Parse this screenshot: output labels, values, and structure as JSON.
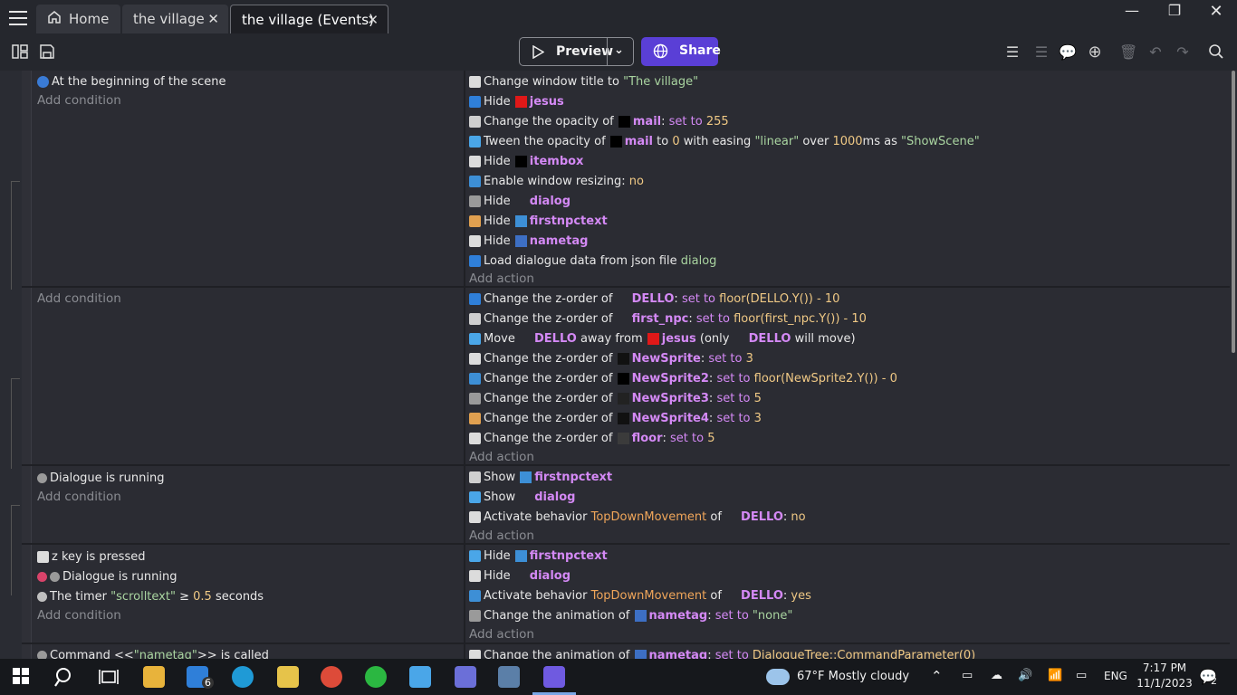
{
  "window": {
    "tabs": [
      {
        "label": "Home"
      },
      {
        "label": "the village"
      },
      {
        "label": "the village (Events)"
      }
    ]
  },
  "toolbar": {
    "preview_label": "Preview",
    "share_label": "Share"
  },
  "events": [
    {
      "conditions": [
        {
          "text": "At the beginning of the scene"
        }
      ],
      "add_condition": "Add condition",
      "actions": [
        {
          "parts": [
            [
              "",
              "Change window title to "
            ],
            [
              "str",
              "\"The village\""
            ]
          ]
        },
        {
          "parts": [
            [
              "",
              "Hide "
            ],
            [
              "obj",
              "jesus"
            ]
          ]
        },
        {
          "parts": [
            [
              "",
              "Change the opacity of "
            ],
            [
              "obj",
              "mail"
            ],
            [
              "",
              ": "
            ],
            [
              "kw",
              "set to "
            ],
            [
              "val",
              "255"
            ]
          ]
        },
        {
          "parts": [
            [
              "",
              "Tween the opacity of "
            ],
            [
              "obj",
              "mail"
            ],
            [
              "",
              " to "
            ],
            [
              "val",
              "0"
            ],
            [
              "",
              " with easing "
            ],
            [
              "str",
              "\"linear\""
            ],
            [
              "",
              " over "
            ],
            [
              "val",
              "1000"
            ],
            [
              "",
              "ms as "
            ],
            [
              "str",
              "\"ShowScene\""
            ]
          ]
        },
        {
          "parts": [
            [
              "",
              "Hide "
            ],
            [
              "obj",
              "itembox"
            ]
          ]
        },
        {
          "parts": [
            [
              "",
              "Enable window resizing: "
            ],
            [
              "val",
              "no"
            ]
          ]
        },
        {
          "parts": [
            [
              "",
              "Hide "
            ],
            [
              "obj",
              "dialog"
            ]
          ]
        },
        {
          "parts": [
            [
              "",
              "Hide "
            ],
            [
              "obj",
              "firstnpctext"
            ]
          ]
        },
        {
          "parts": [
            [
              "",
              "Hide "
            ],
            [
              "obj",
              "nametag"
            ]
          ]
        },
        {
          "parts": [
            [
              "",
              "Load dialogue data from json file "
            ],
            [
              "str",
              "dialog"
            ]
          ]
        }
      ],
      "add_action": "Add action"
    },
    {
      "conditions": [],
      "add_condition": "Add condition",
      "actions": [
        {
          "parts": [
            [
              "",
              "Change the z-order of "
            ],
            [
              "obj",
              "DELLO"
            ],
            [
              "",
              ": "
            ],
            [
              "kw",
              "set to "
            ],
            [
              "val",
              "floor(DELLO.Y()) - 10"
            ]
          ]
        },
        {
          "parts": [
            [
              "",
              "Change the z-order of "
            ],
            [
              "obj",
              "first_npc"
            ],
            [
              "",
              ": "
            ],
            [
              "kw",
              "set to "
            ],
            [
              "val",
              "floor(first_npc.Y()) - 10"
            ]
          ]
        },
        {
          "parts": [
            [
              "",
              "Move "
            ],
            [
              "obj",
              "DELLO"
            ],
            [
              "",
              " away from "
            ],
            [
              "obj",
              "jesus"
            ],
            [
              "",
              " (only "
            ],
            [
              "obj",
              "DELLO"
            ],
            [
              "",
              " will move)"
            ]
          ]
        },
        {
          "parts": [
            [
              "",
              "Change the z-order of "
            ],
            [
              "obj",
              "NewSprite"
            ],
            [
              "",
              ": "
            ],
            [
              "kw",
              "set to "
            ],
            [
              "val",
              "3"
            ]
          ]
        },
        {
          "parts": [
            [
              "",
              "Change the z-order of "
            ],
            [
              "obj",
              "NewSprite2"
            ],
            [
              "",
              ": "
            ],
            [
              "kw",
              "set to "
            ],
            [
              "val",
              "floor(NewSprite2.Y()) - 0"
            ]
          ]
        },
        {
          "parts": [
            [
              "",
              "Change the z-order of "
            ],
            [
              "obj",
              "NewSprite3"
            ],
            [
              "",
              ": "
            ],
            [
              "kw",
              "set to "
            ],
            [
              "val",
              "5"
            ]
          ]
        },
        {
          "parts": [
            [
              "",
              "Change the z-order of "
            ],
            [
              "obj",
              "NewSprite4"
            ],
            [
              "",
              ": "
            ],
            [
              "kw",
              "set to "
            ],
            [
              "val",
              "3"
            ]
          ]
        },
        {
          "parts": [
            [
              "",
              "Change the z-order of "
            ],
            [
              "obj",
              "floor"
            ],
            [
              "",
              ": "
            ],
            [
              "kw",
              "set to "
            ],
            [
              "val",
              "5"
            ]
          ]
        }
      ],
      "add_action": "Add action"
    },
    {
      "conditions": [
        {
          "text": "Dialogue is running"
        }
      ],
      "add_condition": "Add condition",
      "actions": [
        {
          "parts": [
            [
              "",
              "Show "
            ],
            [
              "obj",
              "firstnpctext"
            ]
          ]
        },
        {
          "parts": [
            [
              "",
              "Show "
            ],
            [
              "obj",
              "dialog"
            ]
          ]
        },
        {
          "parts": [
            [
              "",
              "Activate behavior "
            ],
            [
              "beh",
              "TopDownMovement"
            ],
            [
              "",
              " of "
            ],
            [
              "obj",
              "DELLO"
            ],
            [
              "",
              ": "
            ],
            [
              "val",
              "no"
            ]
          ]
        }
      ],
      "add_action": "Add action"
    },
    {
      "conditions": [
        {
          "text": "z key is pressed"
        },
        {
          "text": "Dialogue is running"
        },
        {
          "parts": [
            [
              "",
              "The timer "
            ],
            [
              "str",
              "\"scrolltext\""
            ],
            [
              "",
              " ≥ "
            ],
            [
              "val",
              "0.5"
            ],
            [
              "",
              " seconds"
            ]
          ]
        }
      ],
      "add_condition": "Add condition",
      "actions": [
        {
          "parts": [
            [
              "",
              "Hide "
            ],
            [
              "obj",
              "firstnpctext"
            ]
          ]
        },
        {
          "parts": [
            [
              "",
              "Hide "
            ],
            [
              "obj",
              "dialog"
            ]
          ]
        },
        {
          "parts": [
            [
              "",
              "Activate behavior "
            ],
            [
              "beh",
              "TopDownMovement"
            ],
            [
              "",
              " of "
            ],
            [
              "obj",
              "DELLO"
            ],
            [
              "",
              ": "
            ],
            [
              "val",
              "yes"
            ]
          ]
        },
        {
          "parts": [
            [
              "",
              "Change the animation of "
            ],
            [
              "obj",
              "nametag"
            ],
            [
              "",
              ": "
            ],
            [
              "kw",
              "set to "
            ],
            [
              "str",
              "\"none\""
            ]
          ]
        }
      ],
      "add_action": "Add action"
    },
    {
      "conditions": [
        {
          "parts": [
            [
              "",
              "Command <<"
            ],
            [
              "str",
              "\"nametag\""
            ],
            [
              "",
              ">> is called"
            ]
          ]
        }
      ],
      "actions": [
        {
          "parts": [
            [
              "",
              "Change the animation of "
            ],
            [
              "obj",
              "nametag"
            ],
            [
              "",
              ": "
            ],
            [
              "kw",
              "set to "
            ],
            [
              "val",
              "DialogueTree::CommandParameter(0)"
            ]
          ]
        }
      ]
    }
  ],
  "taskbar": {
    "weather": "67°F  Mostly cloudy",
    "lang": "ENG",
    "time": "7:17 PM",
    "date": "11/1/2023",
    "mail_badge": "6",
    "notif_count": "2"
  },
  "colors": {
    "share": "#5a3fd6",
    "object": "#d489f5",
    "value": "#f0c985",
    "string": "#a9d4a0",
    "behavior": "#f0a65a"
  }
}
